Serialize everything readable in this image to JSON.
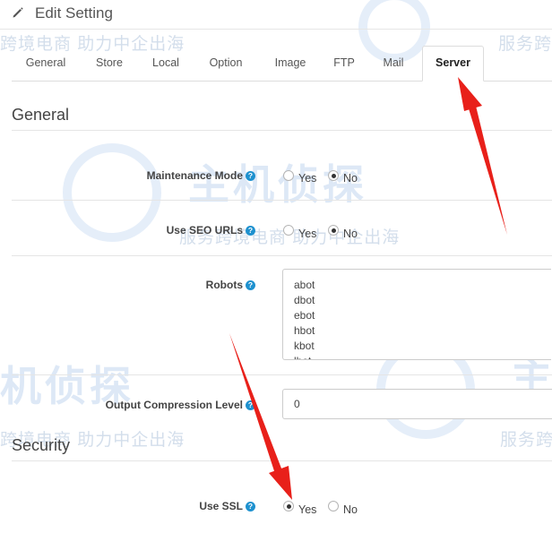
{
  "header": {
    "title": "Edit Setting",
    "icon": "pencil-icon"
  },
  "tabs": [
    {
      "label": "General"
    },
    {
      "label": "Store"
    },
    {
      "label": "Local"
    },
    {
      "label": "Option"
    },
    {
      "label": "Image"
    },
    {
      "label": "FTP"
    },
    {
      "label": "Mail"
    },
    {
      "label": "Server",
      "active": true
    }
  ],
  "sections": {
    "general": {
      "title": "General"
    },
    "security": {
      "title": "Security"
    }
  },
  "fields": {
    "maintenance_mode": {
      "label": "Maintenance Mode",
      "options": [
        "Yes",
        "No"
      ],
      "selected": "No"
    },
    "seo_urls": {
      "label": "Use SEO URLs",
      "options": [
        "Yes",
        "No"
      ],
      "selected": "No"
    },
    "robots": {
      "label": "Robots",
      "lines": [
        "abot",
        "dbot",
        "ebot",
        "hbot",
        "kbot",
        "lbot"
      ]
    },
    "compression": {
      "label": "Output Compression Level",
      "value": "0"
    },
    "use_ssl": {
      "label": "Use SSL",
      "options": [
        "Yes",
        "No"
      ],
      "selected": "Yes"
    }
  },
  "help_icon_glyph": "?",
  "watermark": {
    "brand": "主机侦探",
    "tagline": "服务跨境电商 助力中企出海",
    "tagline_alt": "跨境电商 助力中企出海",
    "tagline_short": "服务跨",
    "tagline_short2": "服务跨",
    "brand_fragment": "主",
    "brand_fragment2": "机侦探",
    "color": "#9fc0e6"
  },
  "accent_color": "#1e91cf",
  "arrow_color": "#e8201a"
}
